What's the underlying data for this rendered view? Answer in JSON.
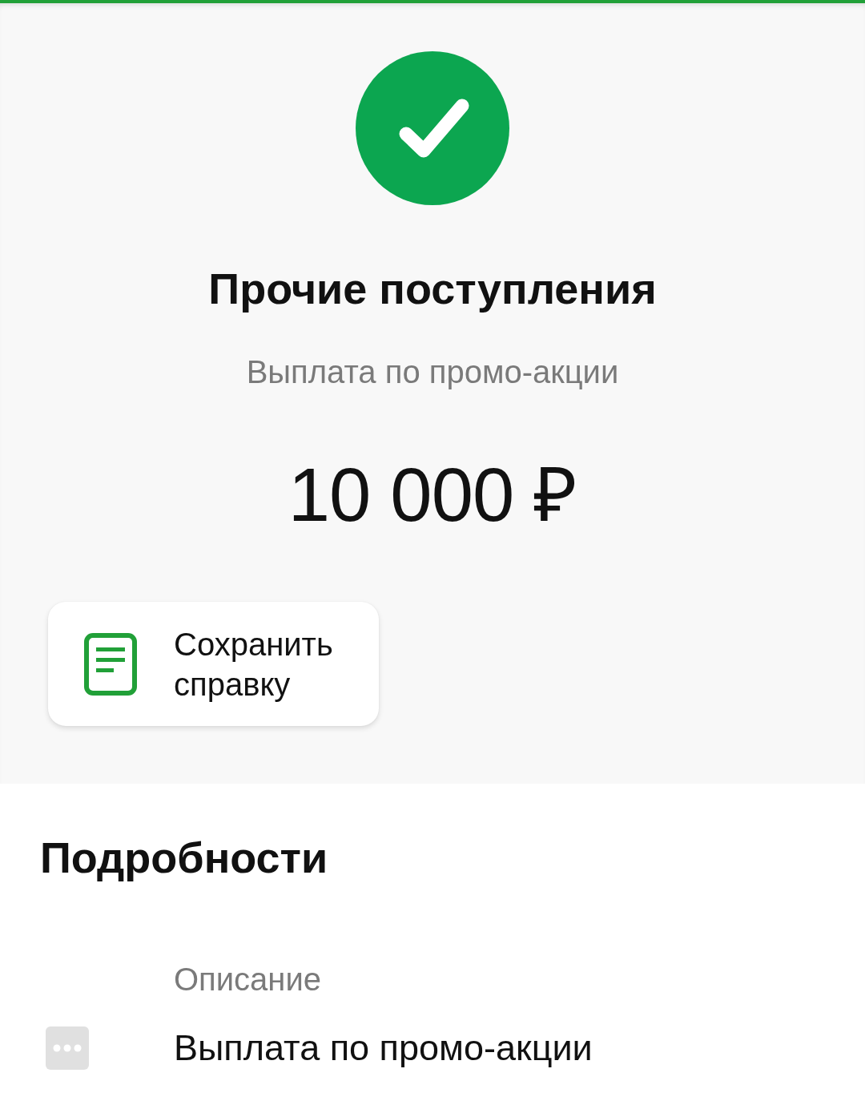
{
  "title": "Прочие поступления",
  "subtitle": "Выплата по промо-акции",
  "amount": "10 000 ₽",
  "actions": [
    {
      "label": "Сохранить справку"
    }
  ],
  "details": {
    "heading": "Подробности",
    "items": [
      {
        "label": "Описание",
        "value": "Выплата по промо-акции"
      }
    ]
  }
}
